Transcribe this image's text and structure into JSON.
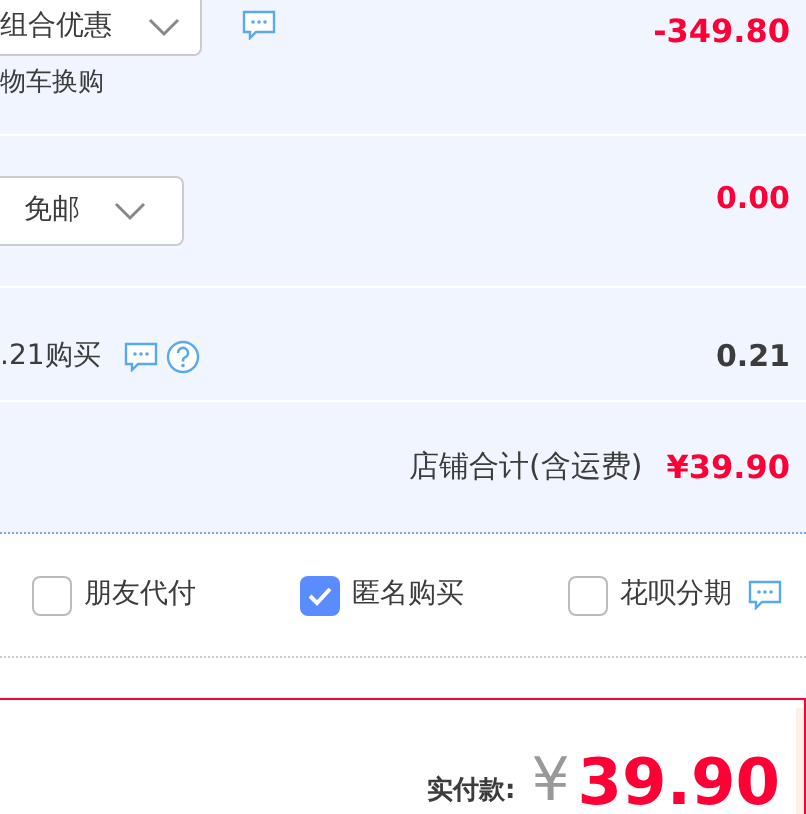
{
  "discount_row": {
    "dropdown": "组合优惠",
    "note": "物车换购",
    "amount": "-349.80"
  },
  "shipping_row": {
    "dropdown": "免邮",
    "amount": "0.00"
  },
  "insurance_row": {
    "label": ".21购买",
    "amount": "0.21"
  },
  "shop_total": {
    "label": "店铺合计(含运费)",
    "amount": "¥39.90"
  },
  "options": [
    {
      "label": "朋友代付",
      "checked": false,
      "comment_icon": false
    },
    {
      "label": "匿名购买",
      "checked": true,
      "comment_icon": false
    },
    {
      "label": "花呗分期",
      "checked": false,
      "comment_icon": true
    }
  ],
  "payment": {
    "label": "实付款:",
    "currency": "¥",
    "amount": "39.90"
  }
}
